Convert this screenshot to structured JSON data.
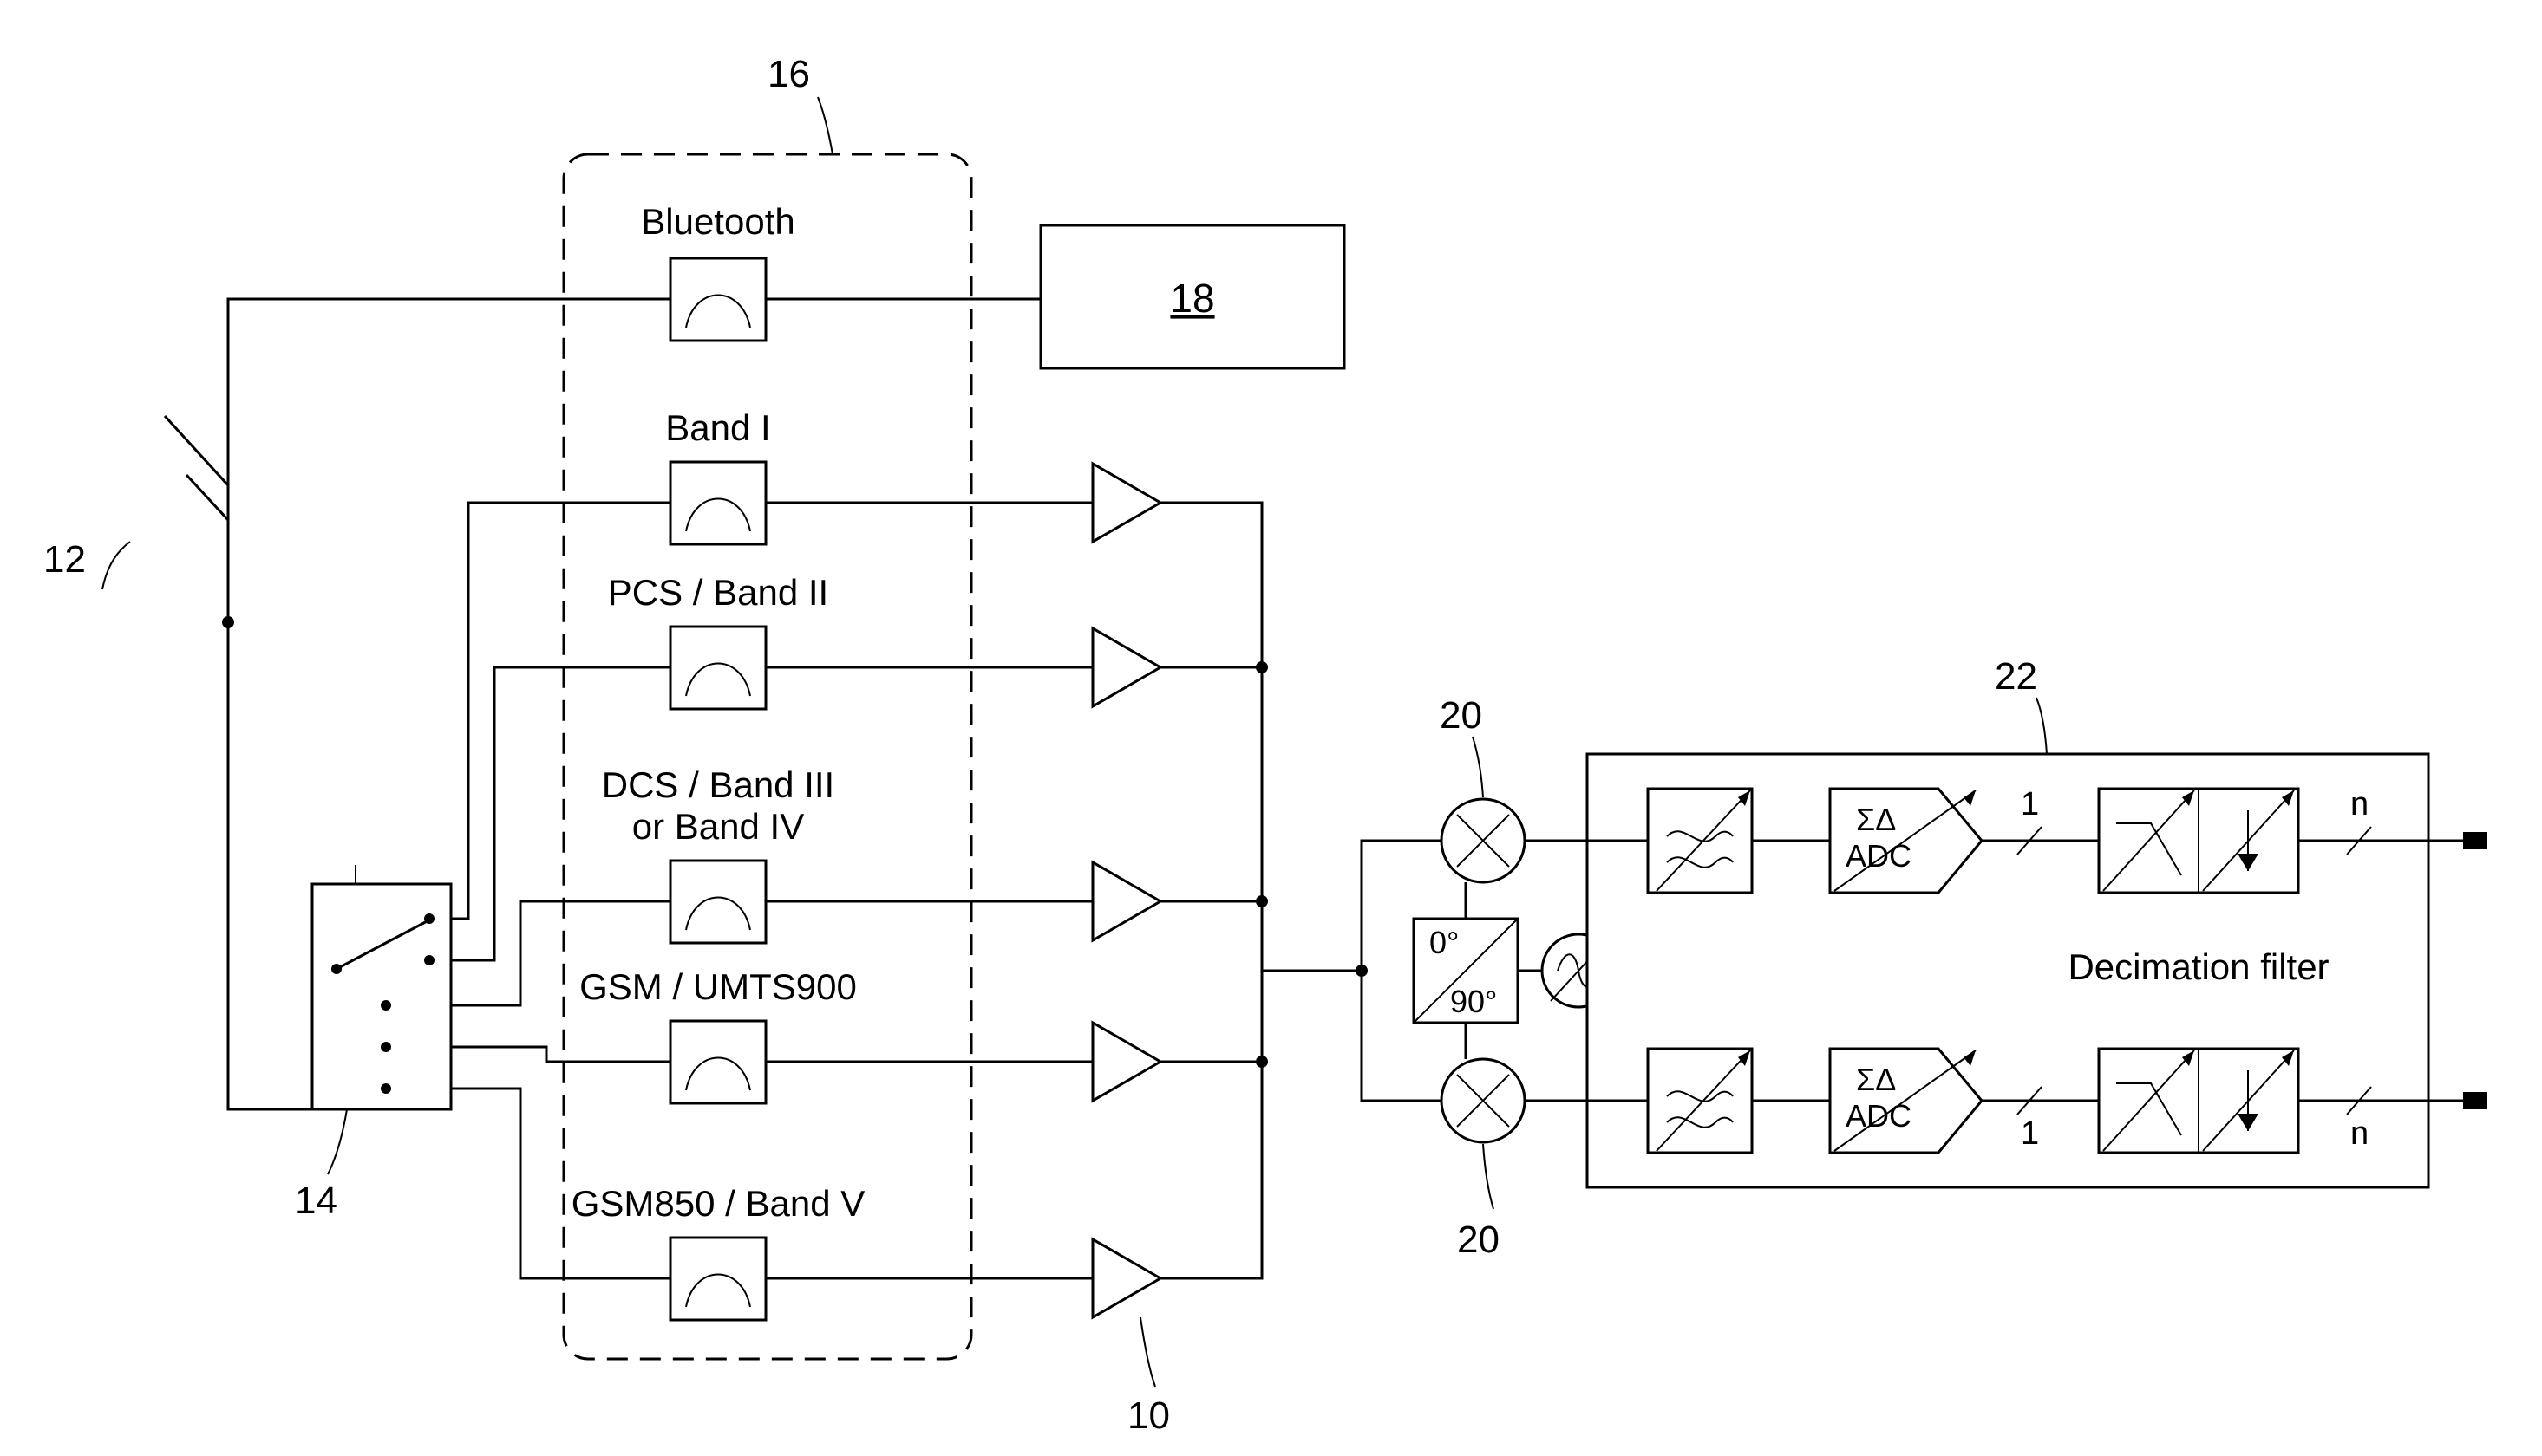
{
  "refs": {
    "antenna": "12",
    "switch": "14",
    "filter_bank": "16",
    "bt_block": "18",
    "lna": "10",
    "mixer_top": "20",
    "mixer_bottom": "20",
    "adc_block": "22"
  },
  "filters": {
    "bluetooth": "Bluetooth",
    "band1": "Band I",
    "band2": "PCS / Band II",
    "band3_line1": "DCS / Band III",
    "band3_line2": "or Band IV",
    "band4": "GSM / UMTS900",
    "band5": "GSM850 / Band V"
  },
  "iq": {
    "zero": "0°",
    "ninety": "90°"
  },
  "adc": {
    "sigma_delta": "ΣΔ",
    "label": "ADC",
    "one_bit": "1",
    "n_bit": "n",
    "decimation": "Decimation filter"
  }
}
